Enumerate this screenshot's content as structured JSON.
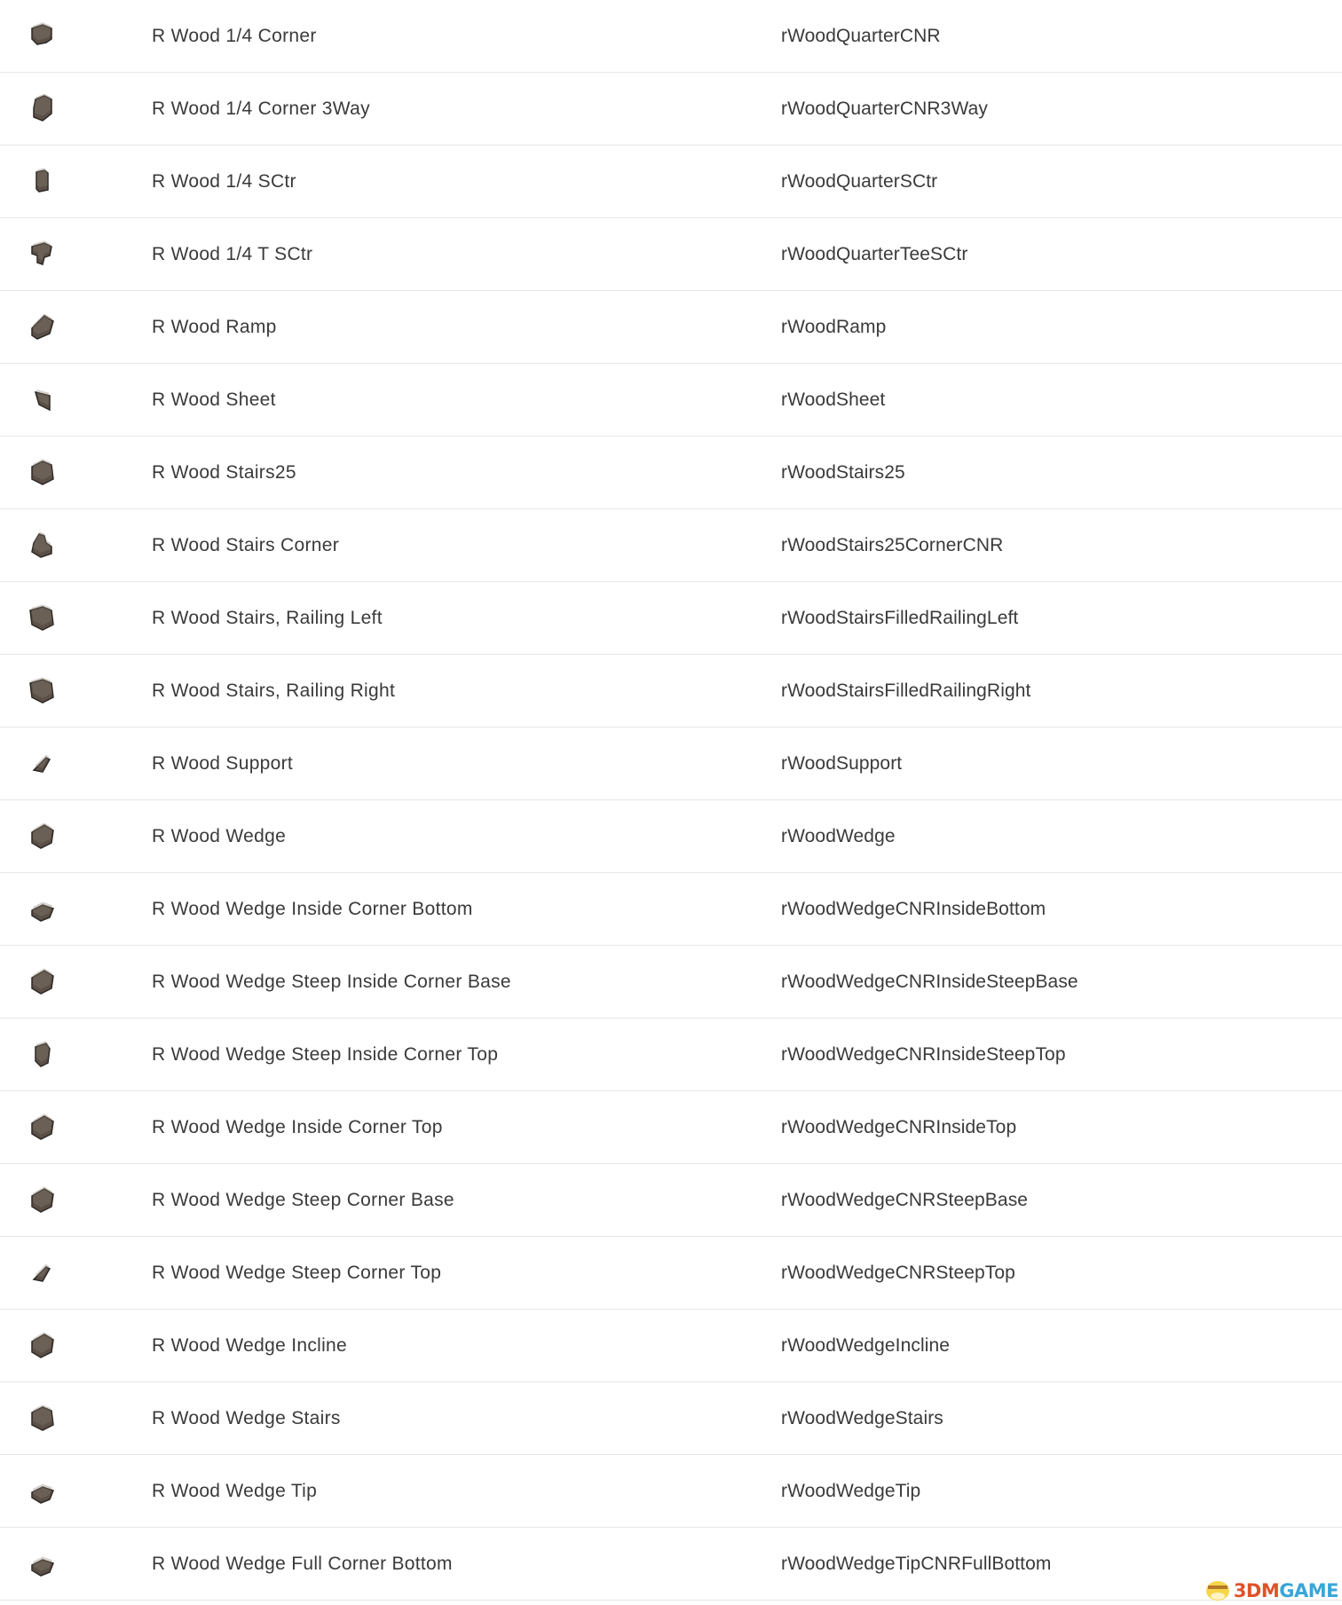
{
  "rows": [
    {
      "name": "R Wood 1/4 Corner",
      "code": "rWoodQuarterCNR",
      "icon": "quarter-corner"
    },
    {
      "name": "R Wood 1/4 Corner 3Way",
      "code": "rWoodQuarterCNR3Way",
      "icon": "quarter-corner-3way"
    },
    {
      "name": "R Wood 1/4 SCtr",
      "code": "rWoodQuarterSCtr",
      "icon": "quarter-sctr"
    },
    {
      "name": "R Wood 1/4 T SCtr",
      "code": "rWoodQuarterTeeSCtr",
      "icon": "quarter-tee"
    },
    {
      "name": "R Wood Ramp",
      "code": "rWoodRamp",
      "icon": "ramp"
    },
    {
      "name": "R Wood Sheet",
      "code": "rWoodSheet",
      "icon": "sheet"
    },
    {
      "name": "R Wood Stairs25",
      "code": "rWoodStairs25",
      "icon": "stairs"
    },
    {
      "name": "R Wood Stairs Corner",
      "code": "rWoodStairs25CornerCNR",
      "icon": "stairs-corner"
    },
    {
      "name": "R Wood Stairs, Railing Left",
      "code": "rWoodStairsFilledRailingLeft",
      "icon": "stairs-railing"
    },
    {
      "name": "R Wood Stairs, Railing Right",
      "code": "rWoodStairsFilledRailingRight",
      "icon": "stairs-railing"
    },
    {
      "name": "R Wood Support",
      "code": "rWoodSupport",
      "icon": "support"
    },
    {
      "name": "R Wood Wedge",
      "code": "rWoodWedge",
      "icon": "wedge"
    },
    {
      "name": "R Wood Wedge Inside Corner Bottom",
      "code": "rWoodWedgeCNRInsideBottom",
      "icon": "wedge-flat"
    },
    {
      "name": "R Wood Wedge Steep Inside Corner Base",
      "code": "rWoodWedgeCNRInsideSteepBase",
      "icon": "wedge"
    },
    {
      "name": "R Wood Wedge Steep Inside Corner Top",
      "code": "rWoodWedgeCNRInsideSteepTop",
      "icon": "wedge-tall"
    },
    {
      "name": "R Wood Wedge Inside Corner Top",
      "code": "rWoodWedgeCNRInsideTop",
      "icon": "wedge"
    },
    {
      "name": "R Wood Wedge Steep Corner Base",
      "code": "rWoodWedgeCNRSteepBase",
      "icon": "wedge"
    },
    {
      "name": "R Wood Wedge Steep Corner Top",
      "code": "rWoodWedgeCNRSteepTop",
      "icon": "support"
    },
    {
      "name": "R Wood Wedge Incline",
      "code": "rWoodWedgeIncline",
      "icon": "wedge"
    },
    {
      "name": "R Wood Wedge Stairs",
      "code": "rWoodWedgeStairs",
      "icon": "stairs"
    },
    {
      "name": "R Wood Wedge Tip",
      "code": "rWoodWedgeTip",
      "icon": "wedge-flat"
    },
    {
      "name": "R Wood Wedge Full Corner Bottom",
      "code": "rWoodWedgeTipCNRFullBottom",
      "icon": "wedge-flat"
    }
  ],
  "watermark": {
    "part1": "3DM",
    "part2": "GAME"
  },
  "colors": {
    "icon": "#5a5048",
    "divider": "#e6e6e6",
    "text": "#3a3a3a"
  }
}
